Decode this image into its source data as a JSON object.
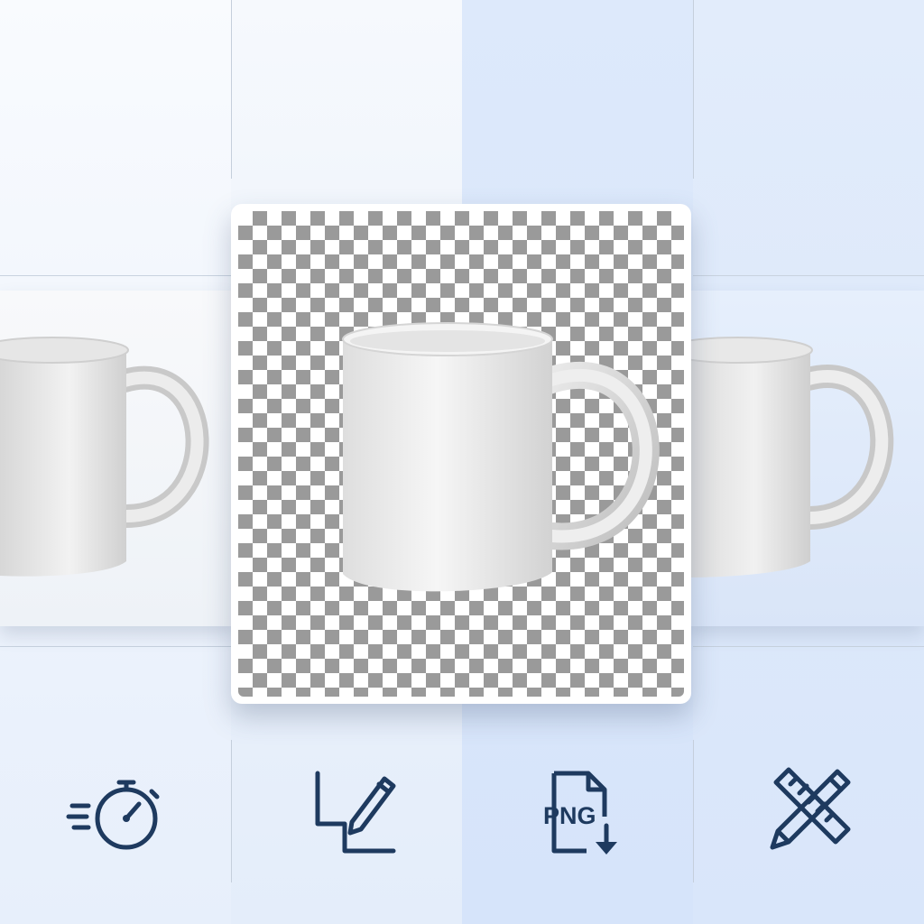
{
  "icons": [
    {
      "name": "stopwatch-icon"
    },
    {
      "name": "edit-line-icon"
    },
    {
      "name": "png-download-icon",
      "label": "PNG"
    },
    {
      "name": "ruler-pencil-icon"
    }
  ],
  "colors": {
    "icon": "#1e3a5f",
    "checker_dark": "#9a9a9a",
    "checker_light": "#ffffff",
    "mug": "#eeeeee"
  }
}
